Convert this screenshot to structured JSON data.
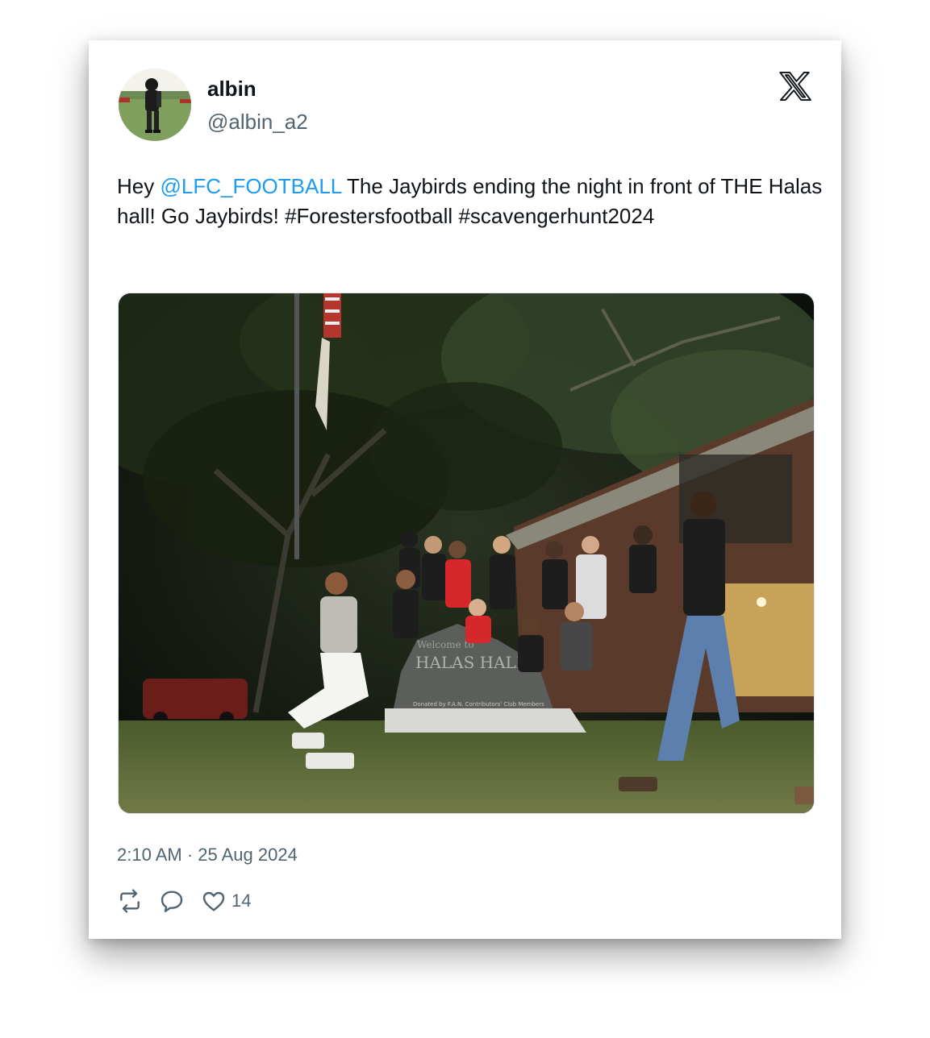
{
  "author": {
    "display_name": "albin",
    "handle": "@albin_a2",
    "avatar_icon": "avatar-photo"
  },
  "platform_icon": "x-logo-icon",
  "tweet": {
    "text_prefix": "Hey ",
    "mention": "@LFC_FOOTBALL",
    "text_main": " The Jaybirds ending the night in front of THE Halas hall! Go Jaybirds! ",
    "hashtag_1": "#Forestersfootball",
    "text_space": " ",
    "hashtag_2": "#scavengerhunt2024"
  },
  "media": {
    "sign_text_line1": "Welcome to",
    "sign_text_line2": "HALAS HALL",
    "sign_text_footer": "Donated by F.A.N. Contributors' Club Members"
  },
  "timestamp": "2:10 AM · 25 Aug 2024",
  "actions": {
    "retweet_icon": "retweet-icon",
    "reply_icon": "reply-icon",
    "like_icon": "heart-icon",
    "like_count": "14"
  },
  "colors": {
    "mention": "#1d9bf0",
    "text": "#0f1419",
    "secondary": "#536471"
  }
}
